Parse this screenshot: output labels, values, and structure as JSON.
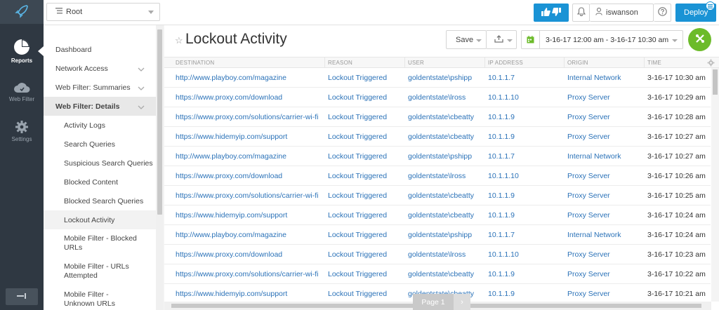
{
  "header": {
    "root_label": "Root",
    "user_name": "iswanson",
    "deploy_label": "Deploy"
  },
  "rail": {
    "items": [
      {
        "label": "Reports",
        "icon": "pie-chart-icon",
        "active": true
      },
      {
        "label": "Web Filter",
        "icon": "cloud-icon",
        "active": false
      },
      {
        "label": "Settings",
        "icon": "gear-icon",
        "active": false
      }
    ]
  },
  "nav": {
    "items": [
      {
        "label": "Dashboard"
      },
      {
        "label": "Network Access"
      },
      {
        "label": "Web Filter: Summaries"
      },
      {
        "label": "Web Filter: Details"
      },
      {
        "label": "Activity Logs"
      },
      {
        "label": "Search Queries"
      },
      {
        "label": "Suspicious Search Queries"
      },
      {
        "label": "Blocked Content"
      },
      {
        "label": "Blocked Search Queries"
      },
      {
        "label": "Lockout Activity"
      },
      {
        "label": "Mobile Filter - Blocked URLs"
      },
      {
        "label": "Mobile Filter - URLs Attempted"
      },
      {
        "label": "Mobile Filter - Unknown URLs"
      }
    ]
  },
  "main": {
    "title": "Lockout Activity",
    "save_label": "Save",
    "date_range": "3-16-17 12:00 am - 3-16-17 10:30 am",
    "pager_label": "Page 1"
  },
  "table": {
    "columns": [
      "DESTINATION",
      "REASON",
      "USER",
      "IP ADDRESS",
      "ORIGIN",
      "TIME"
    ],
    "rows": [
      [
        "http://www.playboy.com/magazine",
        "Lockout Triggered",
        "goldentstate\\pshipp",
        "10.1.1.7",
        "Internal Network",
        "3-16-17 10:30 am"
      ],
      [
        "https://www.proxy.com/download",
        "Lockout Triggered",
        "goldentstate\\lross",
        "10.1.1.10",
        "Proxy Server",
        "3-16-17 10:29 am"
      ],
      [
        "https://www.proxy.com/solutions/carrier-wi-fi",
        "Lockout Triggered",
        "goldentstate\\cbeatty",
        "10.1.1.9",
        "Proxy Server",
        "3-16-17 10:28 am"
      ],
      [
        "https://www.hidemyip.com/support",
        "Lockout Triggered",
        "goldentstate\\cbeatty",
        "10.1.1.9",
        "Proxy Server",
        "3-16-17 10:27 am"
      ],
      [
        "http://www.playboy.com/magazine",
        "Lockout Triggered",
        "goldentstate\\pshipp",
        "10.1.1.7",
        "Internal Network",
        "3-16-17 10:27 am"
      ],
      [
        "https://www.proxy.com/download",
        "Lockout Triggered",
        "goldentstate\\lross",
        "10.1.1.10",
        "Proxy Server",
        "3-16-17 10:26 am"
      ],
      [
        "https://www.proxy.com/solutions/carrier-wi-fi",
        "Lockout Triggered",
        "goldentstate\\cbeatty",
        "10.1.1.9",
        "Proxy Server",
        "3-16-17 10:25 am"
      ],
      [
        "https://www.hidemyip.com/support",
        "Lockout Triggered",
        "goldentstate\\cbeatty",
        "10.1.1.9",
        "Proxy Server",
        "3-16-17 10:24 am"
      ],
      [
        "http://www.playboy.com/magazine",
        "Lockout Triggered",
        "goldentstate\\pshipp",
        "10.1.1.7",
        "Internal Network",
        "3-16-17 10:24 am"
      ],
      [
        "https://www.proxy.com/download",
        "Lockout Triggered",
        "goldentstate\\lross",
        "10.1.1.10",
        "Proxy Server",
        "3-16-17 10:23 am"
      ],
      [
        "https://www.proxy.com/solutions/carrier-wi-fi",
        "Lockout Triggered",
        "goldentstate\\cbeatty",
        "10.1.1.9",
        "Proxy Server",
        "3-16-17 10:22 am"
      ],
      [
        "https://www.hidemyip.com/support",
        "Lockout Triggered",
        "goldentstate\\cbeatty",
        "10.1.1.9",
        "Proxy Server",
        "3-16-17 10:21 am"
      ]
    ]
  },
  "colors": {
    "rail_bg": "#2f3842",
    "accent_blue": "#1a93d5",
    "fab_green": "#6cbb2a",
    "link_blue": "#2b72b8"
  }
}
